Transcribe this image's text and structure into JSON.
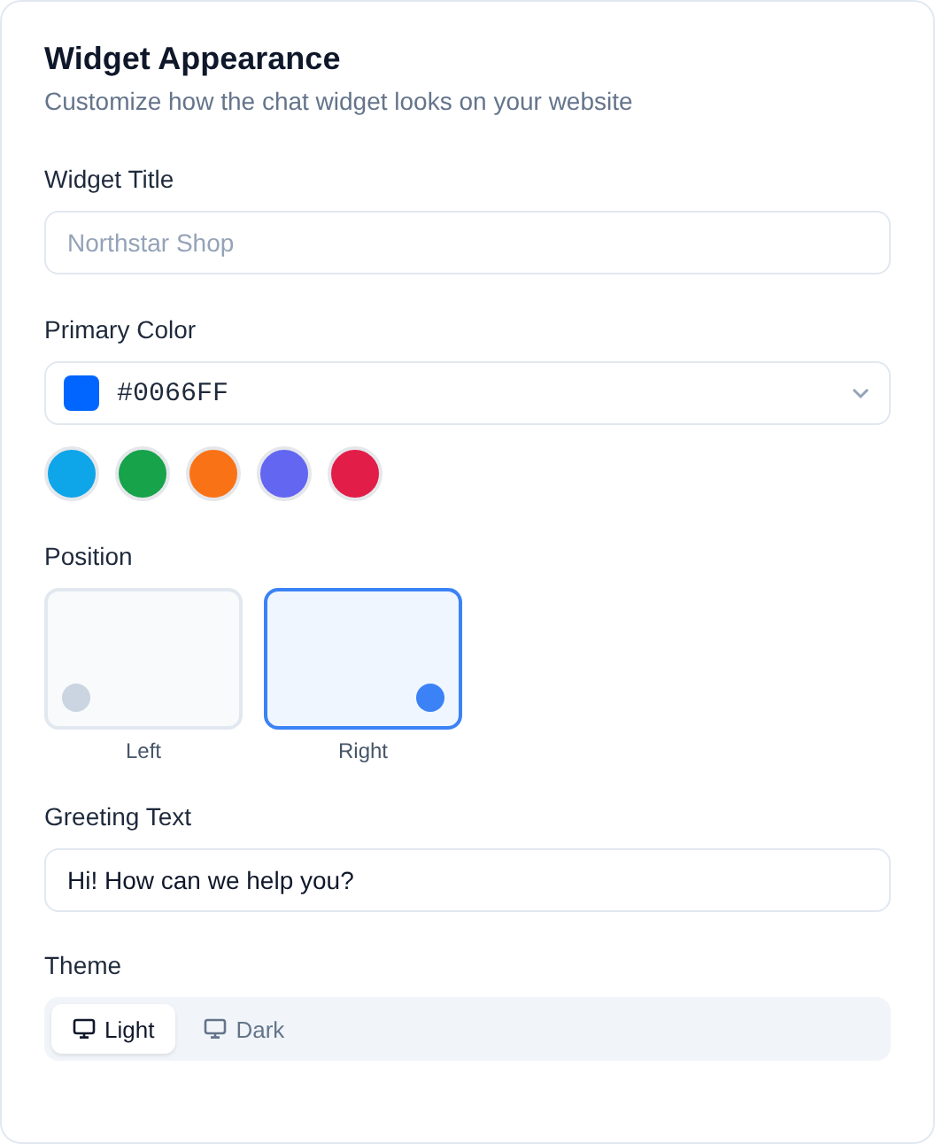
{
  "header": {
    "title": "Widget Appearance",
    "subtitle": "Customize how the chat widget looks on your website"
  },
  "widget_title": {
    "label": "Widget Title",
    "placeholder": "Northstar Shop"
  },
  "primary_color": {
    "label": "Primary Color",
    "value": "#0066FF",
    "color": "#0066ff"
  },
  "color_presets": [
    {
      "color": "#0ea5e9",
      "selected": false
    },
    {
      "color": "#16a34a",
      "selected": false
    },
    {
      "color": "#f97316",
      "selected": false
    },
    {
      "color": "#6366f1",
      "selected": false
    },
    {
      "color": "#e11d48",
      "selected": false
    }
  ],
  "position": {
    "label": "Position",
    "options": [
      {
        "label": "Left",
        "kind": "left",
        "selected": false
      },
      {
        "label": "Right",
        "kind": "right",
        "selected": true
      }
    ]
  },
  "greeting": {
    "label": "Greeting Text",
    "value": "Hi! How can we help you?"
  },
  "theme": {
    "label": "Theme",
    "options": [
      {
        "label": "Light",
        "selected": true
      },
      {
        "label": "Dark",
        "selected": false
      }
    ]
  }
}
